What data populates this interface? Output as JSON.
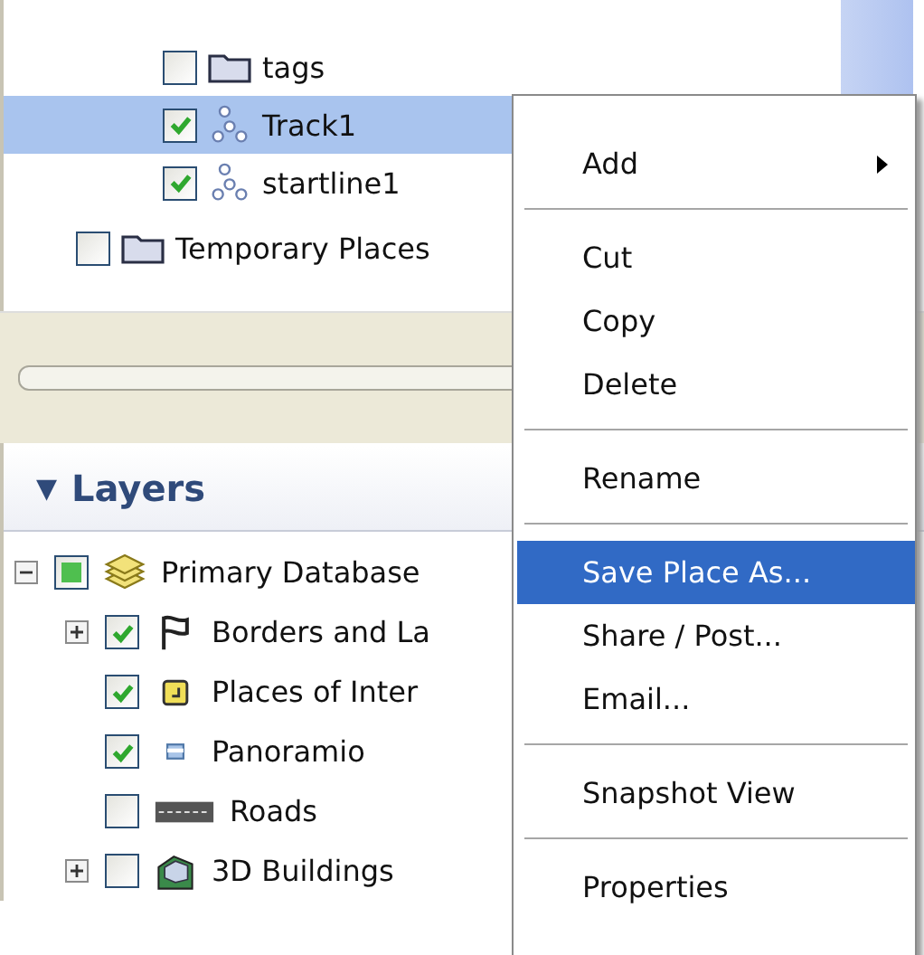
{
  "places_tree": [
    {
      "children": [
        {
          "label": "tags",
          "kind": "folder",
          "checked": false,
          "selected": false
        },
        {
          "label": "Track1",
          "kind": "track",
          "checked": true,
          "selected": true
        },
        {
          "label": "startline1",
          "kind": "track",
          "checked": true,
          "selected": false
        }
      ]
    },
    {
      "label": "Temporary Places",
      "kind": "folder",
      "checked": false,
      "selected": false
    }
  ],
  "layers": {
    "toggle": "▼",
    "title": "Layers",
    "items": [
      {
        "label": "Primary Database",
        "kind": "database",
        "checked": true,
        "partial": true,
        "expanded": true,
        "children": [
          {
            "label": "Borders and La",
            "kind": "flag",
            "checked": true,
            "expanded": false
          },
          {
            "label": "Places of Inter",
            "kind": "poi",
            "checked": true
          },
          {
            "label": "Panoramio",
            "kind": "photo",
            "checked": true
          },
          {
            "label": "Roads",
            "kind": "road",
            "checked": false
          },
          {
            "label": "3D Buildings",
            "kind": "building",
            "checked": false,
            "expanded": false
          }
        ]
      }
    ]
  },
  "context_menu": [
    {
      "kind": "item",
      "label": "Add",
      "submenu": true,
      "selected": false
    },
    {
      "kind": "separator"
    },
    {
      "kind": "item",
      "label": "Cut",
      "selected": false
    },
    {
      "kind": "item",
      "label": "Copy",
      "selected": false
    },
    {
      "kind": "item",
      "label": "Delete",
      "selected": false
    },
    {
      "kind": "separator"
    },
    {
      "kind": "item",
      "label": "Rename",
      "selected": false
    },
    {
      "kind": "separator"
    },
    {
      "kind": "item",
      "label": "Save Place As...",
      "selected": true
    },
    {
      "kind": "item",
      "label": "Share / Post...",
      "selected": false
    },
    {
      "kind": "item",
      "label": "Email...",
      "selected": false
    },
    {
      "kind": "separator"
    },
    {
      "kind": "item",
      "label": "Snapshot View",
      "selected": false
    },
    {
      "kind": "separator"
    },
    {
      "kind": "item",
      "label": "Properties",
      "selected": false
    }
  ]
}
